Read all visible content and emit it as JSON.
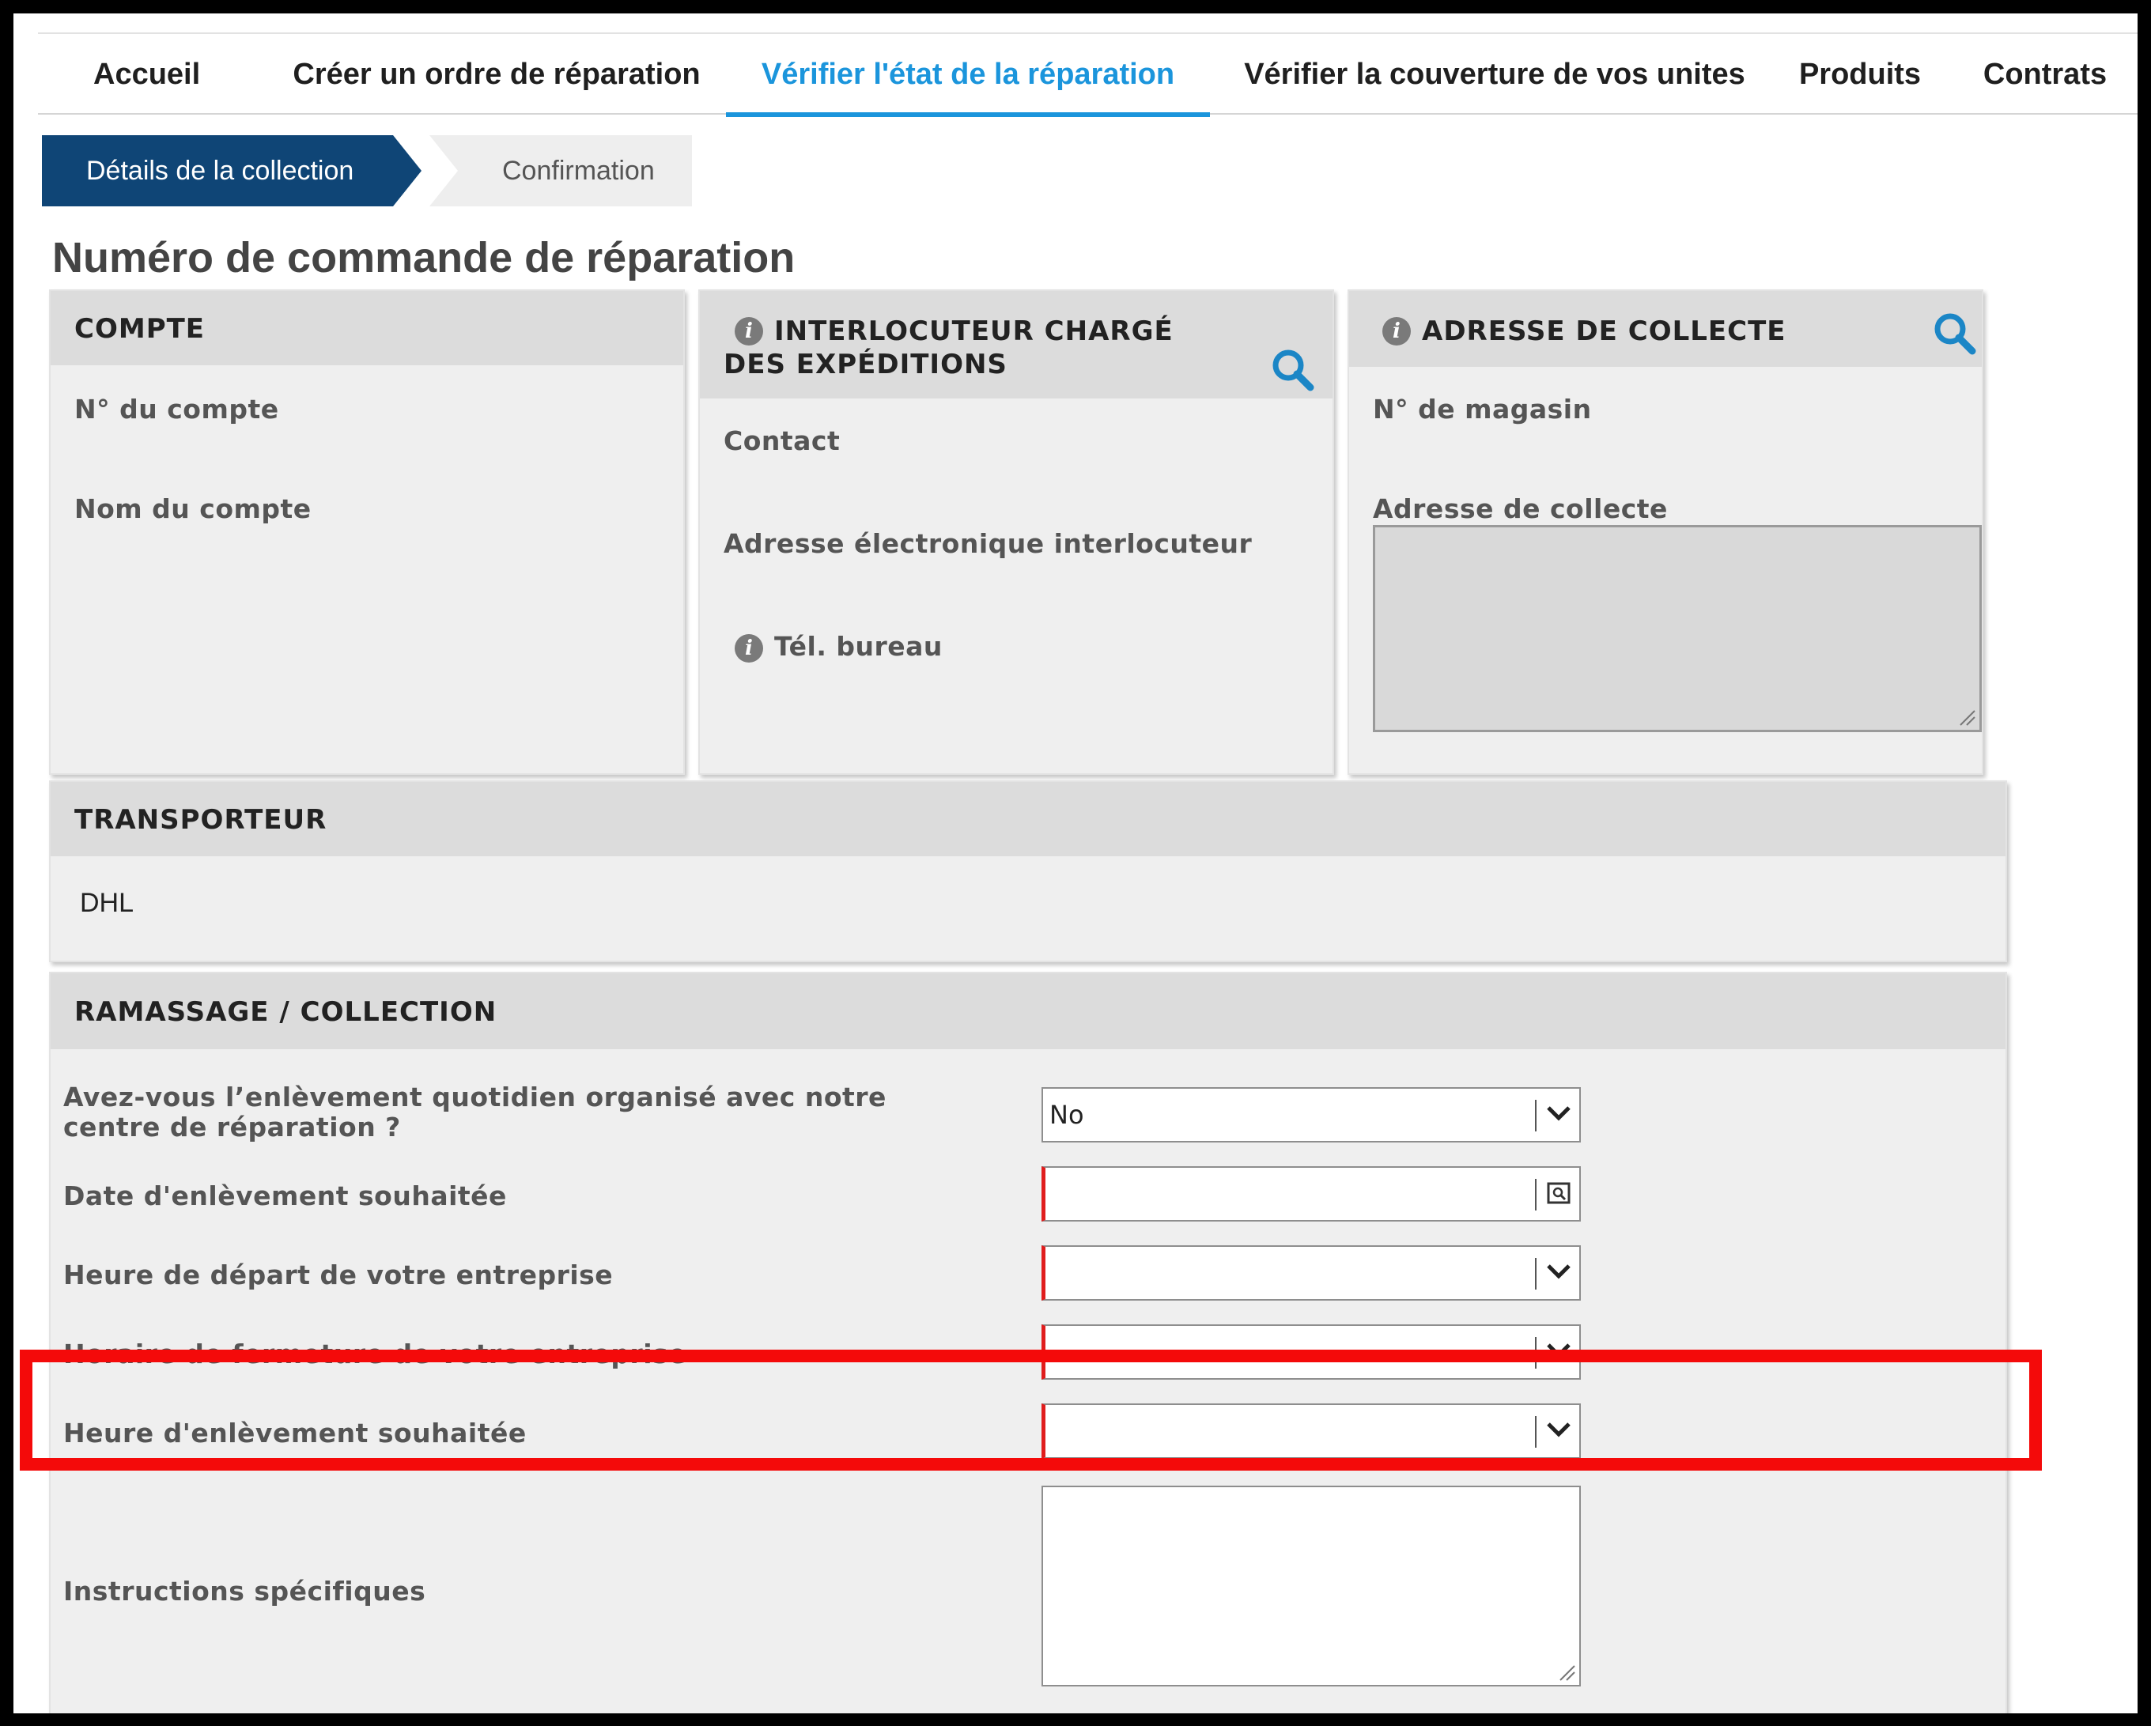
{
  "nav": {
    "items": [
      {
        "label": "Accueil"
      },
      {
        "label": "Créer un ordre de réparation"
      },
      {
        "label": "Vérifier l'état de la réparation",
        "active": true
      },
      {
        "label": "Vérifier la couverture de vos unites"
      },
      {
        "label": "Produits"
      },
      {
        "label": "Contrats"
      }
    ]
  },
  "steps": {
    "current": "Détails de la collection",
    "next": "Confirmation"
  },
  "page_title": "Numéro de commande de réparation",
  "compte": {
    "title": "COMPTE",
    "account_number_label": "N° du compte",
    "account_name_label": "Nom du compte"
  },
  "interlocuteur": {
    "title": "INTERLOCUTEUR CHARGÉ DES EXPÉDITIONS",
    "contact_label": "Contact",
    "email_label": "Adresse électronique interlocuteur",
    "phone_label": "Tél. bureau"
  },
  "adresse": {
    "title": "ADRESSE DE COLLECTE",
    "store_label": "N° de magasin",
    "address_label": "Adresse de collecte"
  },
  "transporteur": {
    "title": "TRANSPORTEUR",
    "value": "DHL"
  },
  "ramassage": {
    "title": "RAMASSAGE / COLLECTION",
    "daily_pickup_label": "Avez-vous l’enlèvement quotidien organisé avec notre centre de réparation ?",
    "daily_pickup_value": "No",
    "date_label": "Date d'enlèvement souhaitée",
    "date_value": "",
    "departure_label": "Heure de départ de votre entreprise",
    "closing_label": "Horaire de fermeture de votre entreprise",
    "pickup_time_label": "Heure d'enlèvement souhaitée",
    "instructions_label": "Instructions spécifiques"
  },
  "colors": {
    "accent": "#1b95dc",
    "step_active": "#0f4576",
    "required": "#e01d1d",
    "highlight": "#f40a0a"
  },
  "icons": [
    "info-icon",
    "search-icon",
    "chevron-down-icon",
    "calendar-icon",
    "resize-grip-icon"
  ]
}
